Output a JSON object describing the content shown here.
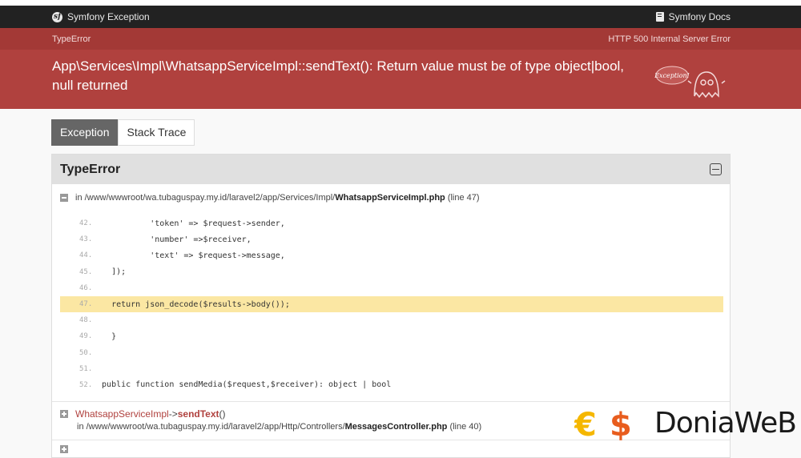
{
  "topbar": {
    "brand": "Symfony Exception",
    "docs": "Symfony Docs"
  },
  "exception": {
    "class": "TypeError",
    "status": "HTTP 500 Internal Server Error",
    "message": "App\\Services\\Impl\\WhatsappServiceImpl::sendText(): Return value must be of type object|bool, null returned",
    "ghost_label": "Exception!"
  },
  "tabs": [
    {
      "label": "Exception"
    },
    {
      "label": "Stack Trace"
    }
  ],
  "panel": {
    "title": "TypeError",
    "trace1": {
      "prefix": "in /www/wwwroot/wa.tubaguspay.my.id/laravel2/app/Services/Impl/",
      "file": "WhatsappServiceImpl.php",
      "line": "(line 47)"
    },
    "code": [
      {
        "no": "42.",
        "src": "            'token' => $request->sender,"
      },
      {
        "no": "43.",
        "src": "            'number' =>$receiver,"
      },
      {
        "no": "44.",
        "src": "            'text' => $request->message,"
      },
      {
        "no": "45.",
        "src": "    ]);"
      },
      {
        "no": "46.",
        "src": ""
      },
      {
        "no": "47.",
        "src": "    return json_decode($results->body());"
      },
      {
        "no": "48.",
        "src": ""
      },
      {
        "no": "49.",
        "src": "    }"
      },
      {
        "no": "50.",
        "src": ""
      },
      {
        "no": "51.",
        "src": ""
      },
      {
        "no": "52.",
        "src": "  public function sendMedia($request,$receiver): object | bool"
      }
    ],
    "trace2": {
      "class": "WhatsappServiceImpl",
      "arrow": "->",
      "func": "sendText",
      "args": "()",
      "prefix": "in /www/wwwroot/wa.tubaguspay.my.id/laravel2/app/Http/Controllers/",
      "file": "MessagesController.php",
      "line": "(line 40)"
    }
  },
  "watermark": {
    "text": "DoniaWeB"
  },
  "colors": {
    "accent": "#b0413e",
    "highlight": "#fbe7a3",
    "topbar": "#222222"
  }
}
